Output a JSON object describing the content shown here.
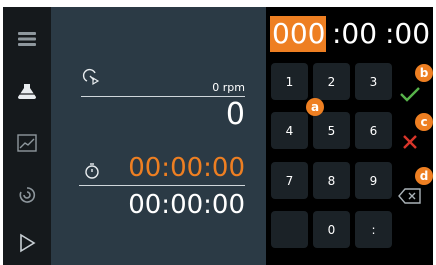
{
  "sidebar": {
    "icons": [
      "menu-icon",
      "flask-icon",
      "chart-icon",
      "swirl-icon",
      "play-icon"
    ]
  },
  "speed": {
    "label": "0 rpm",
    "value": "0"
  },
  "timer": {
    "target": "00:00:00",
    "elapsed": "00:00:00"
  },
  "time_input": {
    "hours": "000",
    "minutes": ":00",
    "seconds": ":00"
  },
  "keypad": {
    "keys": [
      "1",
      "2",
      "3",
      "4",
      "5",
      "6",
      "7",
      "8",
      "9",
      "",
      "0",
      ":"
    ]
  },
  "badges": {
    "a": "a",
    "b": "b",
    "c": "c",
    "d": "d"
  },
  "colors": {
    "accent": "#ee7f22",
    "confirm": "#57b34a",
    "cancel": "#d9352a",
    "panel": "#2b3a45",
    "key": "#1b2227"
  }
}
